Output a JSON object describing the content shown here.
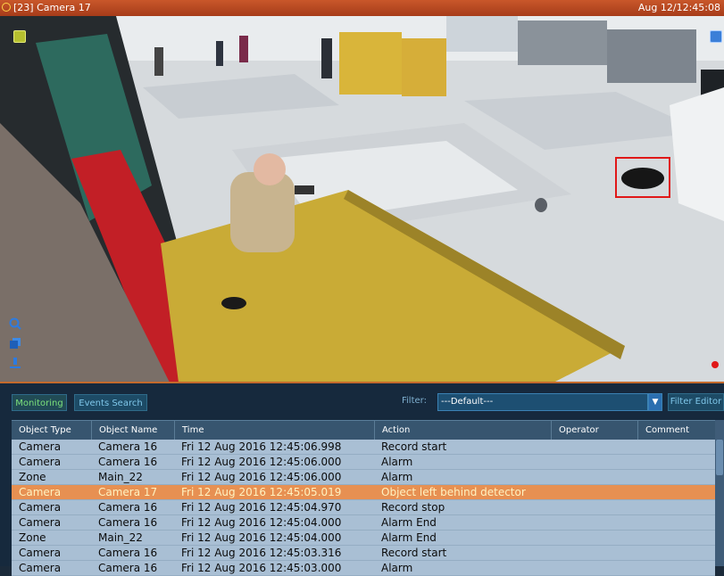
{
  "camera": {
    "title": "[23] Camera 17",
    "timestamp": "Aug 12/12:45:08",
    "detection_label": "Object left behind detector",
    "icons": [
      "recording-indicator-icon",
      "info-icon",
      "snapshot-icon",
      "zoom-icon",
      "copy-icon",
      "save-icon",
      "rec-dot-icon"
    ]
  },
  "events": {
    "tabs": [
      {
        "label": "Monitoring"
      },
      {
        "label": "Events Search"
      }
    ],
    "filter_label": "Filter:",
    "filter_value": "---Default---",
    "filter_editor_label": "Filter Editor",
    "columns": [
      "Object Type",
      "Object Name",
      "Time",
      "Action",
      "Operator",
      "Comment"
    ],
    "rows": [
      {
        "type": "Camera",
        "name": "Camera 16",
        "time": "Fri 12 Aug 2016  12:45:06.998",
        "action": "Record start",
        "operator": "",
        "comment": ""
      },
      {
        "type": "Camera",
        "name": "Camera 16",
        "time": "Fri 12 Aug 2016  12:45:06.000",
        "action": "Alarm",
        "operator": "",
        "comment": ""
      },
      {
        "type": "Zone",
        "name": "Main_22",
        "time": "Fri 12 Aug 2016  12:45:06.000",
        "action": "Alarm",
        "operator": "",
        "comment": ""
      },
      {
        "type": "Camera",
        "name": "Camera 17",
        "time": "Fri 12 Aug 2016  12:45:05.019",
        "action": "Object left behind detector",
        "operator": "",
        "comment": ""
      },
      {
        "type": "Camera",
        "name": "Camera 16",
        "time": "Fri 12 Aug 2016  12:45:04.970",
        "action": "Record stop",
        "operator": "",
        "comment": ""
      },
      {
        "type": "Camera",
        "name": "Camera 16",
        "time": "Fri 12 Aug 2016  12:45:04.000",
        "action": "Alarm End",
        "operator": "",
        "comment": ""
      },
      {
        "type": "Zone",
        "name": "Main_22",
        "time": "Fri 12 Aug 2016  12:45:04.000",
        "action": "Alarm End",
        "operator": "",
        "comment": ""
      },
      {
        "type": "Camera",
        "name": "Camera 16",
        "time": "Fri 12 Aug 2016  12:45:03.316",
        "action": "Record start",
        "operator": "",
        "comment": ""
      },
      {
        "type": "Camera",
        "name": "Camera 16",
        "time": "Fri 12 Aug 2016  12:45:03.000",
        "action": "Alarm",
        "operator": "",
        "comment": ""
      }
    ],
    "highlighted_row": 3,
    "colors": {
      "highlight": "#e79052",
      "row": "#a9bfd4",
      "header": "#37556f",
      "panel": "#16293d",
      "titlebar": "#b8471f"
    }
  }
}
